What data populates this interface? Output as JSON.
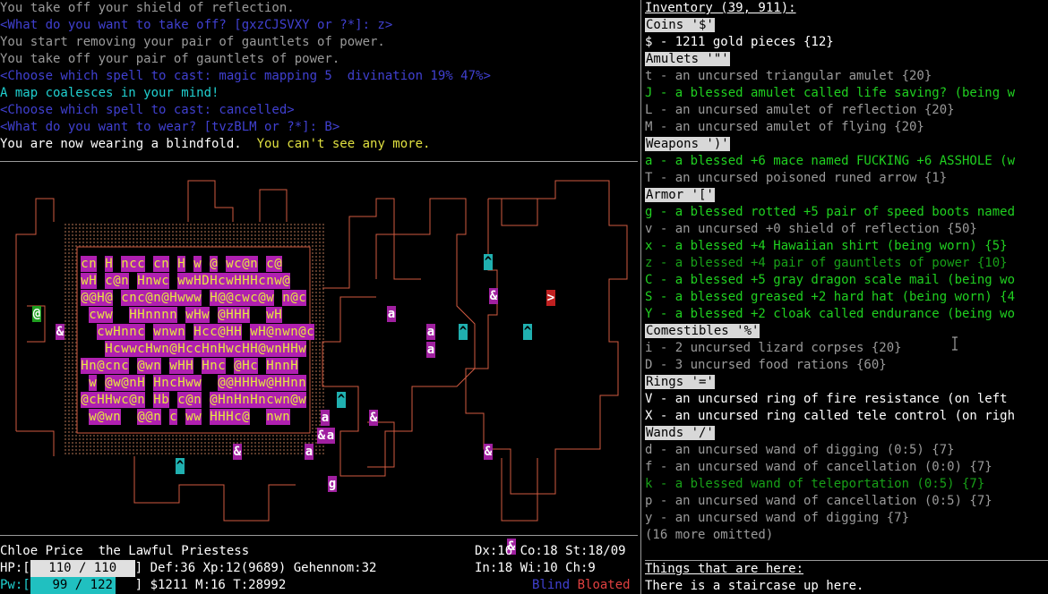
{
  "messages": [
    {
      "text": "You take off your shield of reflection.",
      "color": "#9a9a9a"
    },
    {
      "text": "<What do you want to take off? [gxzCJSVXY or ?*]: z>",
      "color": "#4040d0"
    },
    {
      "text": "You start removing your pair of gauntlets of power.",
      "color": "#9a9a9a"
    },
    {
      "text": "You take off your pair of gauntlets of power.",
      "color": "#9a9a9a"
    },
    {
      "text": "<Choose which spell to cast: magic mapping 5  divination 19% 47%>",
      "color": "#4040d0"
    },
    {
      "text": "A map coalesces in your mind!",
      "color": "#20d0d0"
    },
    {
      "text": "<Choose which spell to cast: cancelled>",
      "color": "#4040d0"
    },
    {
      "text": "<What do you want to wear? [tvzBLM or ?*]: B>",
      "color": "#4040d0"
    }
  ],
  "last_message": {
    "a": "You are now wearing a blindfold.  ",
    "b": "You can't see any more."
  },
  "status": {
    "name": "Chloe Price  the Lawful Priestess",
    "attrs1": "Dx:16 Co:18 St:18/09",
    "attrs2": "In:18 Wi:10 Ch:9",
    "hp_label": "HP:[",
    "hp_value": "110 / 110",
    "hp_fraction": 1.0,
    "row2_rest": "] Def:36 Xp:12(9689) Gehennom:32",
    "pw_label": "Pw:[",
    "pw_value": "99 / 122",
    "pw_fraction": 0.81,
    "row3_rest": "] $1211 M:16 T:28992",
    "cond_blind": "Blind",
    "cond_bloated": "Bloated"
  },
  "inventory": {
    "title": "Inventory (39, 911):",
    "lines": [
      {
        "t": "Coins '$'",
        "kind": "hdr"
      },
      {
        "t": "$ - 1211 gold pieces {12}",
        "kind": "white"
      },
      {
        "t": "Amulets '\"'",
        "kind": "hdr"
      },
      {
        "t": "t - an uncursed triangular amulet {20}",
        "kind": "gray"
      },
      {
        "t": "J - a blessed amulet called life saving? (being w",
        "kind": "green"
      },
      {
        "t": "L - an uncursed amulet of reflection {20}",
        "kind": "gray"
      },
      {
        "t": "M - an uncursed amulet of flying {20}",
        "kind": "gray"
      },
      {
        "t": "Weapons ')'",
        "kind": "hdr"
      },
      {
        "t": "a - a blessed +6 mace named FUCKING +6 ASSHOLE (w",
        "kind": "green"
      },
      {
        "t": "T - an uncursed poisoned runed arrow {1}",
        "kind": "gray"
      },
      {
        "t": "Armor '['",
        "kind": "hdr"
      },
      {
        "t": "g - a blessed rotted +5 pair of speed boots named",
        "kind": "green"
      },
      {
        "t": "v - an uncursed +0 shield of reflection {50}",
        "kind": "gray"
      },
      {
        "t": "x - a blessed +4 Hawaiian shirt (being worn) {5}",
        "kind": "green"
      },
      {
        "t": "z - a blessed +4 pair of gauntlets of power {10}",
        "kind": "dgreen"
      },
      {
        "t": "C - a blessed +5 gray dragon scale mail (being wo",
        "kind": "green"
      },
      {
        "t": "S - a blessed greased +2 hard hat (being worn) {4",
        "kind": "green"
      },
      {
        "t": "Y - a blessed +2 cloak called endurance (being wo",
        "kind": "green"
      },
      {
        "t": "Comestibles '%'",
        "kind": "hdr"
      },
      {
        "t": "i - 2 uncursed lizard corpses {20}",
        "kind": "gray"
      },
      {
        "t": "D - 3 uncursed food rations {60}",
        "kind": "gray"
      },
      {
        "t": "Rings '='",
        "kind": "hdr"
      },
      {
        "t": "V - an uncursed ring of fire resistance (on left",
        "kind": "white"
      },
      {
        "t": "X - an uncursed ring called tele control (on righ",
        "kind": "white"
      },
      {
        "t": "Wands '/'",
        "kind": "hdr"
      },
      {
        "t": "d - an uncursed wand of digging (0:5) {7}",
        "kind": "gray"
      },
      {
        "t": "f - an uncursed wand of cancellation (0:0) {7}",
        "kind": "gray"
      },
      {
        "t": "k - a blessed wand of teleportation (0:5) {7}",
        "kind": "dgreen"
      },
      {
        "t": "p - an uncursed wand of cancellation (0:5) {7}",
        "kind": "gray"
      },
      {
        "t": "y - an uncursed wand of digging {7}",
        "kind": "gray"
      },
      {
        "t": "(16 more omitted)",
        "kind": "gray"
      }
    ],
    "here_title": "Things that are here:",
    "here_text": "There is a staircase up here."
  },
  "map": {
    "tiles": [
      {
        "ch": "@",
        "bg": "#20a020",
        "fg": "#ffffff"
      },
      {
        "ch": "&",
        "bg": "#a020a0",
        "fg": "#ffffff"
      },
      {
        "ch": "^",
        "bg": "#20b0b0",
        "fg": "#000000"
      },
      {
        "ch": "a",
        "bg": "#a020a0",
        "fg": "#ffffff"
      },
      {
        "ch": ">",
        "bg": "#c02020",
        "fg": "#ffffff"
      },
      {
        "ch": "g",
        "bg": "#a020a0",
        "fg": "#ffffff"
      }
    ]
  },
  "colors": {
    "wall": "#d05a40",
    "monster_bg": "#b020b0",
    "floor_dots": "#5a3a2a"
  }
}
